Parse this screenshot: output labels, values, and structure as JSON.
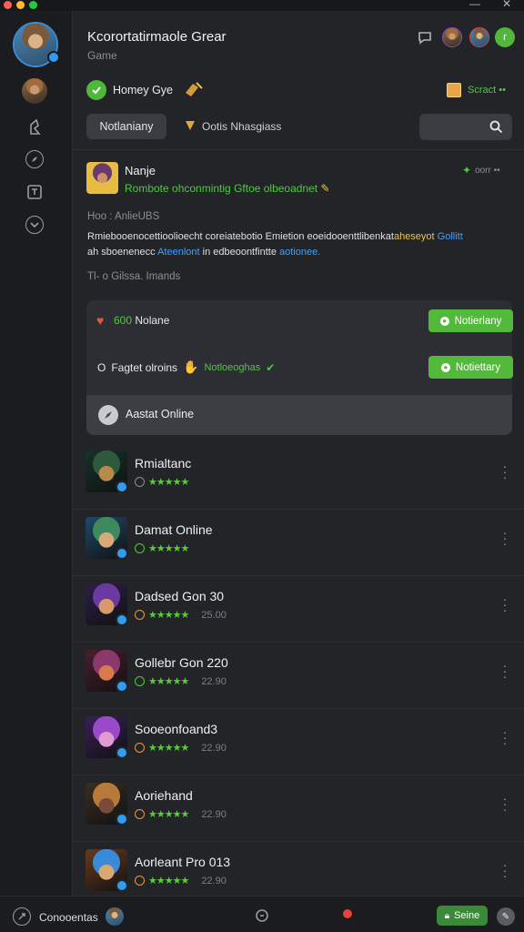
{
  "window": {
    "close_glyph": "✕",
    "minimize_glyph": "—"
  },
  "header": {
    "title": "Kcorortatirmaole Grear",
    "subtitle": "Game",
    "status_label": "Homey Gye",
    "connect_label": "Scract",
    "notification_count": "r"
  },
  "toolbar": {
    "primary_tab": "Notlaniany",
    "secondary_tab": "Ootis Nhasgiass",
    "search_placeholder": ""
  },
  "post": {
    "author": "Nanje",
    "time": "oorr ••",
    "subtitle": "Rombote ohconmintig Gftoe olbeoadnet",
    "section_title": "Hoo : AnlieUBS",
    "body_line1": "Rmiebooenocettioolioecht coreiatebotio Emietion eoeidooenttlibenkat",
    "body_highlight1": "aheseyot",
    "body_highlight2": "Gollitt",
    "body_line2a": "ah sboenenecc",
    "body_highlight3": "Ateenlont",
    "body_line2b": " in edbeoontfintte",
    "body_highlight4": "aotionee.",
    "footnote": "Tl- o Gilssa. Imands"
  },
  "panel": {
    "row1_count": "600",
    "row1_label": "Nolane",
    "row1_button": "Notierlany",
    "row2_prefix": "O",
    "row2_label": "Fagtet olroins",
    "row2_tag": "Notloeoghas",
    "row2_button": "Notiettary",
    "assist_label": "Aastat Online"
  },
  "games": [
    {
      "title": "Rmialtanc",
      "rating_text": "",
      "score": "",
      "icon_color": "grey"
    },
    {
      "title": "Damat Online",
      "rating_text": "",
      "score": "",
      "icon_color": "green"
    },
    {
      "title": "Dadsed Gon 30",
      "rating_text": "",
      "score": "25.00",
      "icon_color": "orange"
    },
    {
      "title": "Gollebr Gon 220",
      "rating_text": "",
      "score": "22.90",
      "icon_color": "green"
    },
    {
      "title": "Sooeonfoand3",
      "rating_text": "",
      "score": "22.90",
      "icon_color": "orange"
    },
    {
      "title": "Aoriehand",
      "rating_text": "",
      "score": "22.90",
      "icon_color": "orange"
    },
    {
      "title": "Aorleant Pro 013",
      "rating_text": "",
      "score": "22.90",
      "icon_color": "orange"
    }
  ],
  "bottom": {
    "label": "Conooentas",
    "action": "Seine"
  },
  "colors": {
    "accent_green": "#53b93b",
    "link_blue": "#3ea0ff",
    "highlight_yellow": "#e8c44a"
  }
}
